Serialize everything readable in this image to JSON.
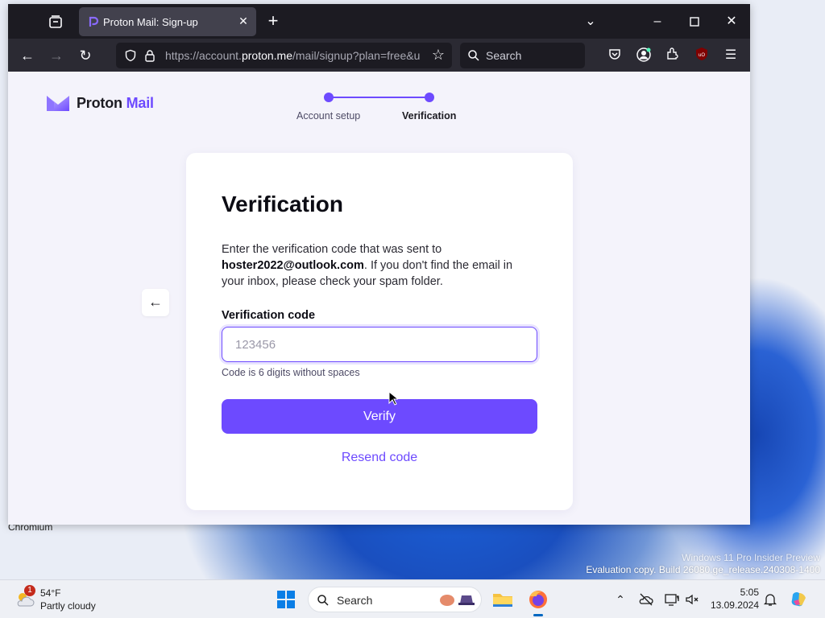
{
  "browser": {
    "tab": {
      "title": "Proton Mail: Sign-up"
    },
    "url": {
      "prefix": "https://account.",
      "host": "proton.me",
      "path": "/mail/signup?plan=free&u"
    },
    "search_placeholder": "Search"
  },
  "page": {
    "brand": {
      "name": "Proton",
      "product": " Mail"
    },
    "steps": [
      {
        "label": "Account setup"
      },
      {
        "label": "Verification"
      }
    ],
    "card": {
      "title": "Verification",
      "desc_before": "Enter the verification code that was sent to ",
      "email": "hoster2022@outlook.com",
      "desc_after": ". If you don't find the email in your inbox, please check your spam folder.",
      "field_label": "Verification code",
      "field_placeholder": "123456",
      "field_value": "",
      "hint": "Code is 6 digits without spaces",
      "verify_label": "Verify",
      "resend_label": "Resend code"
    }
  },
  "desktop": {
    "label": "Chromium",
    "watermark_line1": "Windows 11 Pro Insider Preview",
    "watermark_line2": "Evaluation copy. Build 26080.ge_release.240308-1400"
  },
  "taskbar": {
    "weather": {
      "badge": "1",
      "temp": "54°F",
      "condition": "Partly cloudy"
    },
    "search_placeholder": "Search",
    "clock": {
      "time": "5:05",
      "date": "13.09.2024"
    }
  },
  "colors": {
    "accent": "#6d4aff",
    "browser_dark": "#1c1b22",
    "toolbar": "#2b2a33"
  }
}
